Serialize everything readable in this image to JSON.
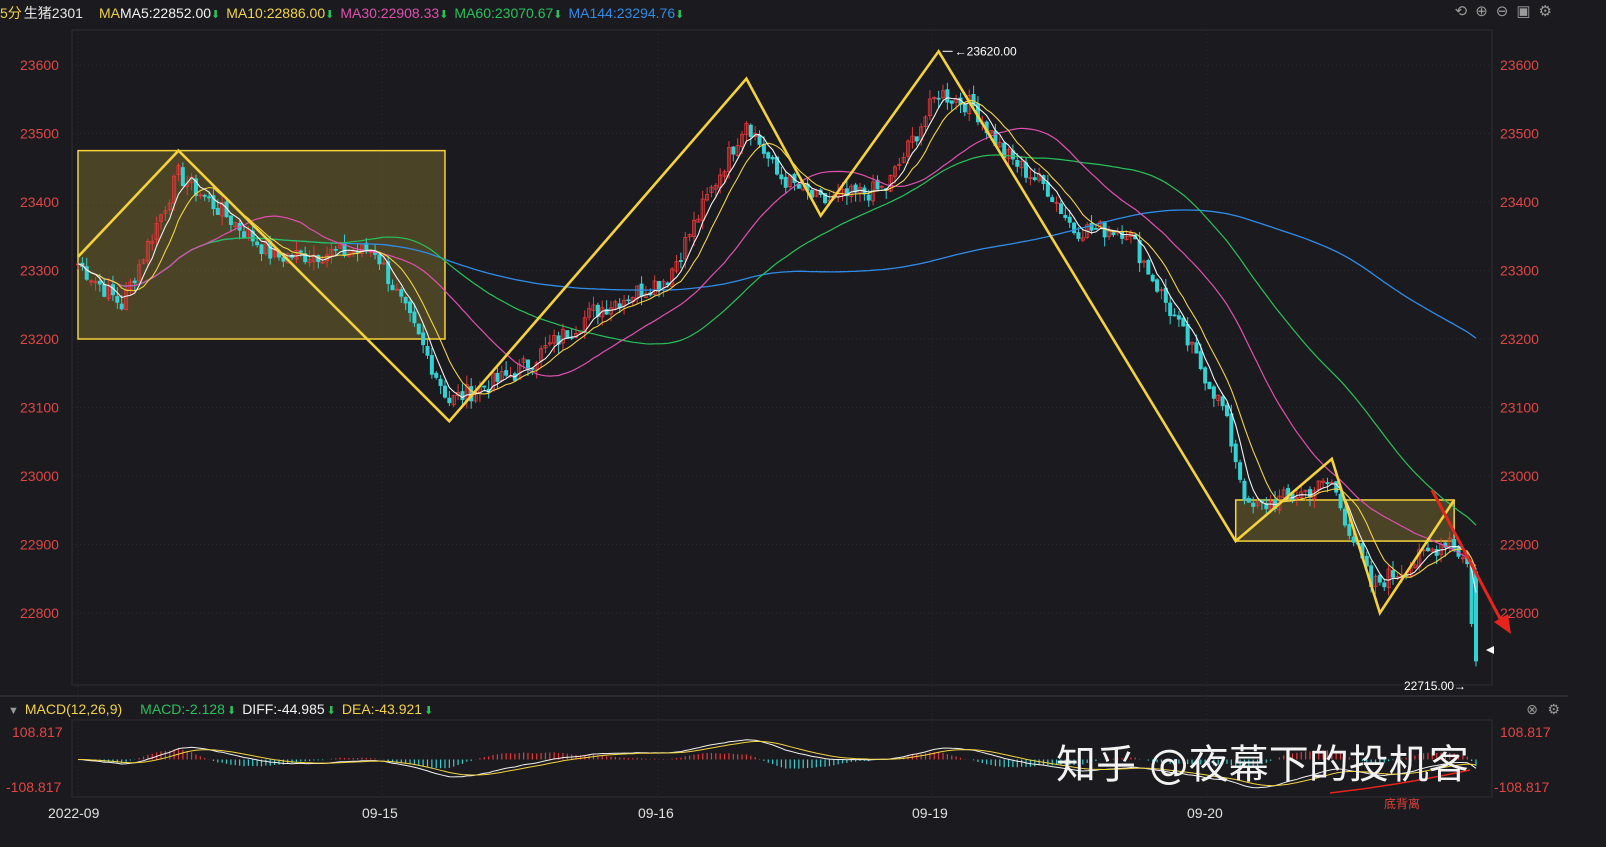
{
  "header": {
    "interval": "5分",
    "symbol": "生猪2301",
    "ma_prefix": "MA",
    "ma5": "MA5:22852.00",
    "ma10": "MA10:22886.00",
    "ma30": "MA30:22908.33",
    "ma60": "MA60:23070.67",
    "ma144": "MA144:23294.76",
    "down_arrow": "⬇"
  },
  "toolbar_icons": [
    "undo-icon",
    "zoom-in-icon",
    "zoom-out-icon",
    "layout-icon",
    "settings-icon"
  ],
  "macd_header": {
    "title": "MACD(12,26,9)",
    "macd": "MACD:-2.128",
    "diff": "DIFF:-44.985",
    "dea": "DEA:-43.921"
  },
  "watermark": "知乎 @夜幕下的投机客",
  "divergence_label": "底背离",
  "colors": {
    "background": "#1b1b1f",
    "up": "#e6383a",
    "down": "#34d1d3",
    "ma5": "#f2f2f2",
    "ma10": "#f2d341",
    "ma30": "#e04fb0",
    "ma60": "#27c25b",
    "ma144": "#2f8ce8",
    "zigzag": "#f5d23b",
    "axis_text": "#e04545"
  },
  "chart_data": {
    "type": "candlestick",
    "y_axis": {
      "range": [
        22700,
        23650
      ],
      "ticks": [
        22800,
        22900,
        23000,
        23100,
        23200,
        23300,
        23400,
        23500,
        23600
      ]
    },
    "macd_axis": {
      "labels": [
        "108.817",
        "-108.817"
      ],
      "range": [
        -108.817,
        108.817
      ]
    },
    "x_labels": [
      "2022-09",
      "09-15",
      "09-16",
      "09-19",
      "09-20"
    ],
    "annotations": {
      "high": "23620.00",
      "low": "22715.00"
    },
    "zigzag": [
      {
        "i": 0,
        "p": 23320
      },
      {
        "i": 23,
        "p": 23475
      },
      {
        "i": 85,
        "p": 23080
      },
      {
        "i": 153,
        "p": 23580
      },
      {
        "i": 170,
        "p": 23380
      },
      {
        "i": 197,
        "p": 23620
      },
      {
        "i": 265,
        "p": 22905
      },
      {
        "i": 287,
        "p": 23025
      },
      {
        "i": 298,
        "p": 22800
      },
      {
        "i": 315,
        "p": 22965
      }
    ],
    "boxes": [
      {
        "i0": 0,
        "i1": 84,
        "p0": 23200,
        "p1": 23475
      },
      {
        "i0": 265,
        "i1": 315,
        "p0": 22905,
        "p1": 22965
      }
    ],
    "key_points": [
      [
        0,
        23310
      ],
      [
        10,
        23250
      ],
      [
        23,
        23440
      ],
      [
        45,
        23320
      ],
      [
        68,
        23330
      ],
      [
        85,
        23110
      ],
      [
        100,
        23150
      ],
      [
        118,
        23240
      ],
      [
        135,
        23290
      ],
      [
        153,
        23520
      ],
      [
        160,
        23440
      ],
      [
        170,
        23400
      ],
      [
        185,
        23420
      ],
      [
        197,
        23560
      ],
      [
        205,
        23540
      ],
      [
        212,
        23470
      ],
      [
        222,
        23420
      ],
      [
        228,
        23360
      ],
      [
        240,
        23360
      ],
      [
        262,
        23100
      ],
      [
        268,
        22950
      ],
      [
        287,
        22990
      ],
      [
        296,
        22840
      ],
      [
        305,
        22870
      ],
      [
        314,
        22910
      ],
      [
        318,
        22870
      ],
      [
        320,
        22715
      ]
    ]
  }
}
